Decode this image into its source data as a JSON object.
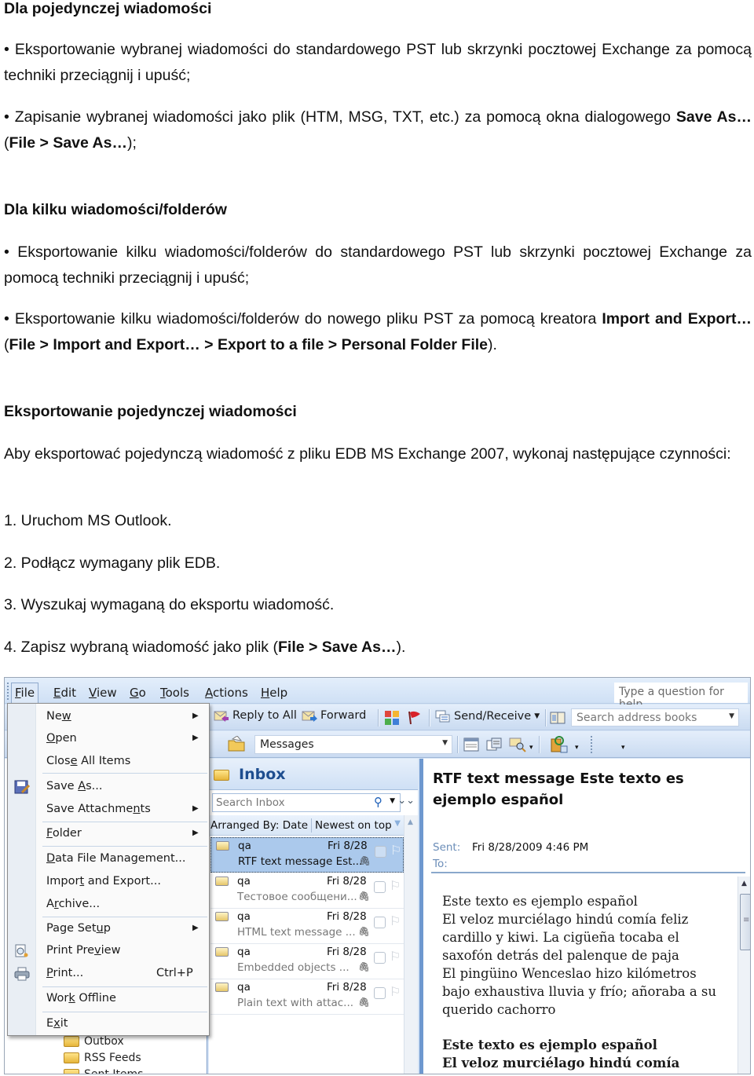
{
  "document": {
    "heading1": "Dla pojedynczej wiadomości",
    "bullet1": "• Eksportowanie wybranej wiadomości do standardowego PST lub skrzynki pocztowej Exchange za pomocą techniki przeciągnij i upuść;",
    "bullet2_pre": "• Zapisanie wybranej wiadomości jako plik (HTM, MSG, TXT, etc.) za pomocą okna dialogowego ",
    "bullet2_bold1": "Save As…",
    "bullet2_mid": " (",
    "bullet2_bold2": "File > Save As…",
    "bullet2_post": ");",
    "heading2": "Dla kilku wiadomości/folderów",
    "bullet3": "• Eksportowanie kilku wiadomości/folderów do standardowego PST lub skrzynki pocztowej Exchange za pomocą techniki przeciągnij i upuść;",
    "bullet4_pre": "• Eksportowanie kilku wiadomości/folderów do nowego pliku PST za pomocą kreatora ",
    "bullet4_bold1": "Import and Export…",
    "bullet4_mid": " (",
    "bullet4_bold2": "File > Import and Export… > Export to a file > Personal Folder File",
    "bullet4_post": ").",
    "heading3": "Eksportowanie pojedynczej wiadomości",
    "intro": "Aby eksportować pojedynczą wiadomość z pliku EDB MS Exchange 2007, wykonaj następujące czynności:",
    "steps": [
      "1. Uruchom MS Outlook.",
      "2. Podłącz wymagany plik EDB.",
      "3. Wyszukaj wymaganą do eksportu wiadomość."
    ],
    "step4_pre": "4. Zapisz wybraną wiadomość jako plik (",
    "step4_bold": "File > Save As…",
    "step4_post": ")."
  },
  "outlook": {
    "menubar": {
      "items": [
        {
          "accel": "F",
          "rest": "ile"
        },
        {
          "accel": "E",
          "rest": "dit"
        },
        {
          "accel": "V",
          "rest": "iew"
        },
        {
          "accel": "G",
          "rest": "o"
        },
        {
          "accel": "T",
          "rest": "ools"
        },
        {
          "accel": "A",
          "rest": "ctions"
        },
        {
          "accel": "H",
          "rest": "elp"
        }
      ],
      "help_placeholder": "Type a question for help"
    },
    "toolbar1": {
      "reply_all": "Reply to All",
      "forward": "Forward",
      "send_receive": "Send/Receive",
      "address_search_placeholder": "Search address books"
    },
    "toolbar2": {
      "view_combo": "Messages"
    },
    "inbox": {
      "title": "Inbox",
      "search_placeholder": "Search Inbox",
      "arranged_by": "Arranged By: Date",
      "sort_order": "Newest on top",
      "messages": [
        {
          "from": "qa",
          "date": "Fri 8/28",
          "subject": "RTF text message Est...",
          "selected": true
        },
        {
          "from": "qa",
          "date": "Fri 8/28",
          "subject": "Тестовое сообщени...",
          "selected": false
        },
        {
          "from": "qa",
          "date": "Fri 8/28",
          "subject": "HTML text message ...",
          "selected": false
        },
        {
          "from": "qa",
          "date": "Fri 8/28",
          "subject": "Embedded objects ...",
          "selected": false
        },
        {
          "from": "qa",
          "date": "Fri 8/28",
          "subject": "Plain text with attac...",
          "selected": false
        }
      ]
    },
    "nav_folders": [
      "Outbox",
      "RSS Feeds",
      "Sent Items"
    ],
    "reading_pane": {
      "subject": "RTF text message Este texto es ejemplo español",
      "sent_label": "Sent:",
      "sent_value": "Fri 8/28/2009 4:46 PM",
      "to_label": "To:",
      "body_lines": [
        "Este texto es ejemplo español",
        "El veloz murciélago hindú comía feliz",
        "cardillo y kiwi. La cigüeña tocaba el",
        "saxofón detrás del palenque de paja",
        "El pingüino Wenceslao hizo kilómetros",
        "bajo exhaustiva lluvia y frío; añoraba a su",
        "querido cachorro"
      ],
      "body_bold_lines": [
        "Este texto es ejemplo español",
        "El veloz murciélago hindú comía"
      ]
    },
    "file_menu": {
      "items": [
        {
          "pre": "Ne",
          "accel": "w",
          "post": "",
          "submenu": true
        },
        {
          "pre": "",
          "accel": "O",
          "post": "pen",
          "submenu": true
        },
        {
          "pre": "Clos",
          "accel": "e",
          "post": " All Items",
          "submenu": false
        },
        {
          "pre": "Save ",
          "accel": "A",
          "post": "s...",
          "submenu": false
        },
        {
          "pre": "Save Attachme",
          "accel": "n",
          "post": "ts",
          "submenu": true
        },
        {
          "pre": "",
          "accel": "F",
          "post": "older",
          "submenu": true
        },
        {
          "pre": "",
          "accel": "D",
          "post": "ata File Management...",
          "submenu": false
        },
        {
          "pre": "Impor",
          "accel": "t",
          "post": " and Export...",
          "submenu": false
        },
        {
          "pre": "A",
          "accel": "r",
          "post": "chive...",
          "submenu": false
        },
        {
          "pre": "Page Set",
          "accel": "u",
          "post": "p",
          "submenu": true
        },
        {
          "pre": "Print Pre",
          "accel": "v",
          "post": "iew",
          "submenu": false
        },
        {
          "pre": "",
          "accel": "P",
          "post": "rint...",
          "submenu": false,
          "shortcut": "Ctrl+P"
        },
        {
          "pre": "Wor",
          "accel": "k",
          "post": " Offline",
          "submenu": false
        },
        {
          "pre": "E",
          "accel": "x",
          "post": "it",
          "submenu": false
        }
      ]
    }
  }
}
